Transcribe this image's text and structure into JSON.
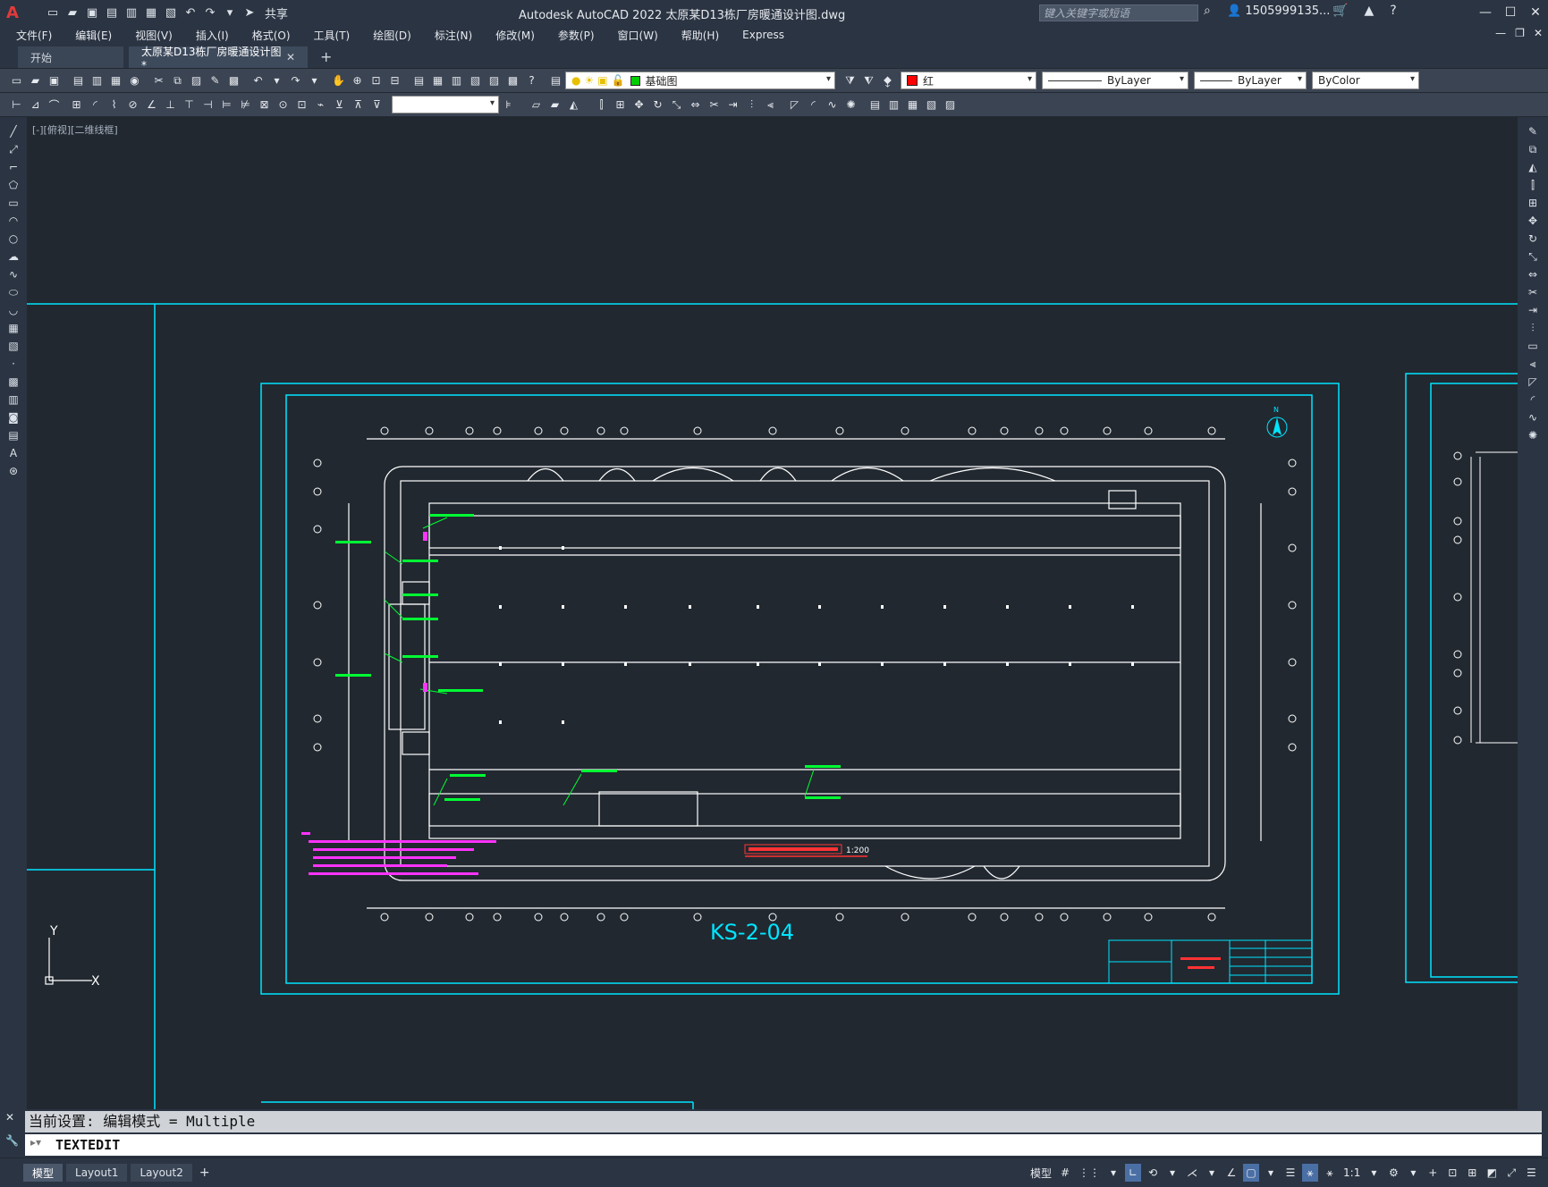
{
  "titlebar": {
    "app_icon": "A",
    "share_label": "共享",
    "title": "Autodesk AutoCAD 2022    太原某D13栋厂房暖通设计图.dwg",
    "search_placeholder": "键入关键字或短语",
    "user": "1505999135..."
  },
  "menubar": {
    "items": [
      "文件(F)",
      "编辑(E)",
      "视图(V)",
      "插入(I)",
      "格式(O)",
      "工具(T)",
      "绘图(D)",
      "标注(N)",
      "修改(M)",
      "参数(P)",
      "窗口(W)",
      "帮助(H)",
      "Express"
    ]
  },
  "tabs": {
    "start": "开始",
    "active": "太原某D13栋厂房暖通设计图*",
    "close": "✕",
    "add": "+"
  },
  "toolbar": {
    "layer": "基础图",
    "layer_color": "#00cc00",
    "color": "红",
    "color_swatch": "#ff0000",
    "linetype": "ByLayer",
    "lineweight": "ByLayer",
    "plotstyle": "ByColor"
  },
  "viewport": {
    "label": "[-][俯视][二维线框]",
    "drawing_number": "KS-2-04",
    "scale": "1:200",
    "north": "N",
    "axis_x": "X",
    "axis_y": "Y"
  },
  "command": {
    "history": "当前设置: 编辑模式 = Multiple",
    "current": "TEXTEDIT"
  },
  "statusbar": {
    "tabs": [
      "模型",
      "Layout1",
      "Layout2"
    ],
    "add": "+",
    "model_label": "模型",
    "scale": "1:1"
  },
  "colors": {
    "cyan": "#00e5ff",
    "green": "#00ff33",
    "magenta": "#ff33ff",
    "white": "#ffffff",
    "background": "#212830"
  }
}
